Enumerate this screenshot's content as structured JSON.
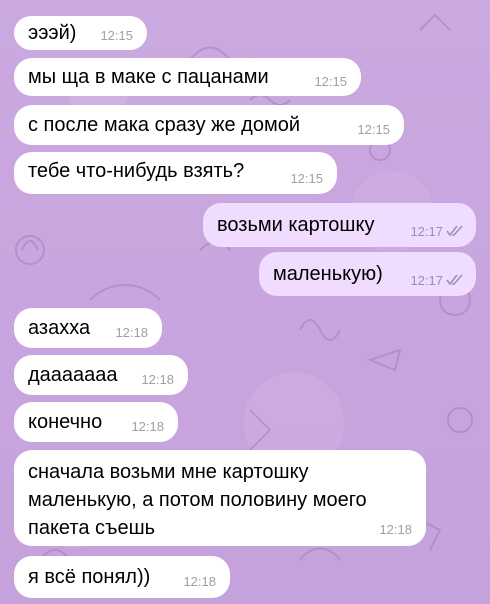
{
  "colors": {
    "background": "#c9a8de",
    "incoming_bubble": "#ffffff",
    "outgoing_bubble": "#efdcff",
    "time_incoming": "#a0a0a0",
    "time_outgoing": "#a489b6"
  },
  "messages": [
    {
      "text": "эээй)",
      "time": "12:15",
      "direction": "in"
    },
    {
      "text": "мы ща в маке с пацанами",
      "time": "12:15",
      "direction": "in"
    },
    {
      "text": "с после мака сразу же домой",
      "time": "12:15",
      "direction": "in"
    },
    {
      "text": "тебе что-нибудь взять?",
      "time": "12:15",
      "direction": "in"
    },
    {
      "text": "возьми картошку",
      "time": "12:17",
      "direction": "out",
      "status_icon": "double-check-icon"
    },
    {
      "text": "маленькую)",
      "time": "12:17",
      "direction": "out",
      "status_icon": "double-check-icon"
    },
    {
      "text": "азахха",
      "time": "12:18",
      "direction": "in"
    },
    {
      "text": "даааааaa",
      "time": "12:18",
      "direction": "in"
    },
    {
      "text": "конечно",
      "time": "12:18",
      "direction": "in"
    },
    {
      "lines": [
        "сначала возьми мне картошку",
        "маленькую, а потом половину моего",
        "пакета съешь"
      ],
      "time": "12:18",
      "direction": "in"
    },
    {
      "text": "я всё понял))",
      "time": "12:18",
      "direction": "in"
    }
  ]
}
